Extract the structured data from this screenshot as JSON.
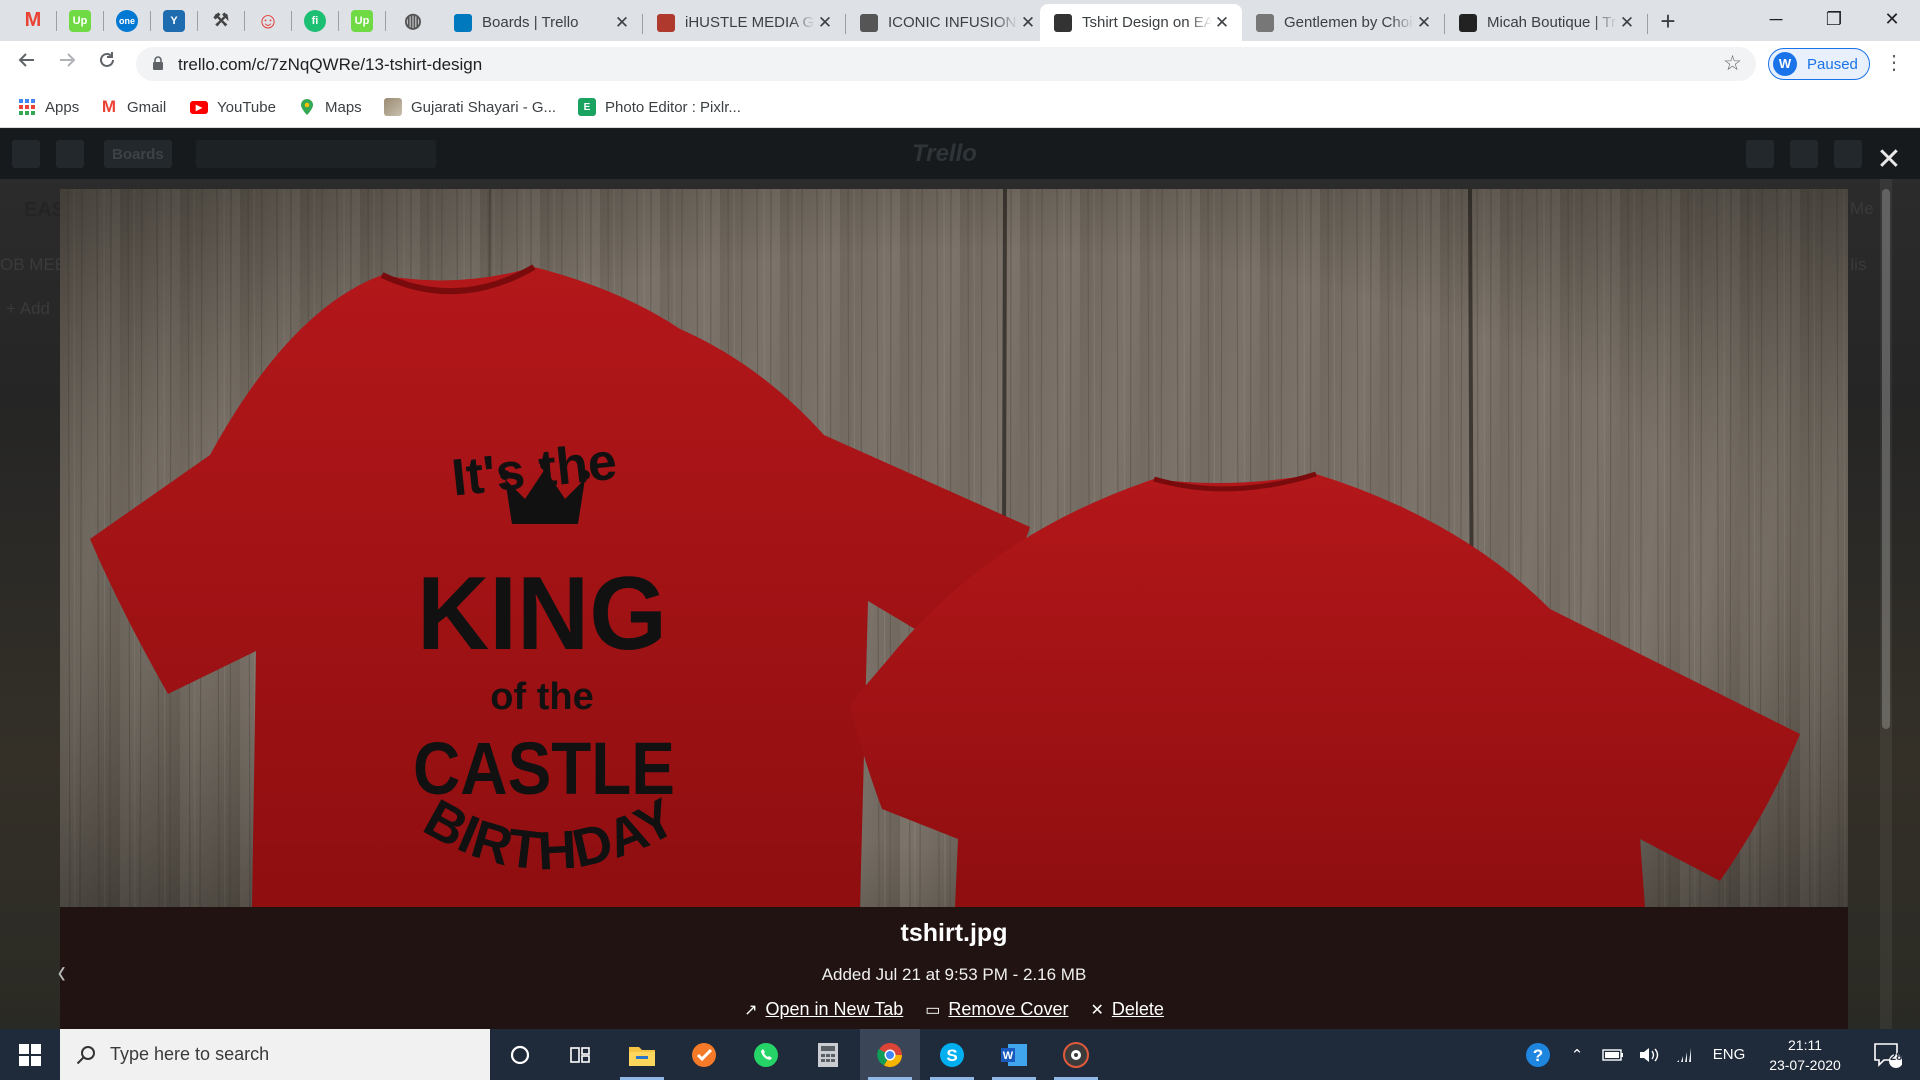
{
  "browser": {
    "pinned_tabs": [
      {
        "icon": "gmail-icon",
        "glyph": "M",
        "color": "#ea4335"
      },
      {
        "icon": "upwork-icon",
        "glyph": "Up",
        "color": "#6fda44"
      },
      {
        "icon": "onedrive-icon",
        "glyph": "one",
        "color": "#0078d4"
      },
      {
        "icon": "yammer-icon",
        "glyph": "Y",
        "color": "#1f6bb0"
      },
      {
        "icon": "tools-icon",
        "glyph": "⚒",
        "color": "#444444"
      },
      {
        "icon": "smiley-icon",
        "glyph": "☺",
        "color": "#e53935"
      },
      {
        "icon": "fiverr-icon",
        "glyph": "fi",
        "color": "#1dbf73"
      },
      {
        "icon": "upwork-icon",
        "glyph": "Up",
        "color": "#6fda44"
      },
      {
        "icon": "globe-icon",
        "glyph": "◍",
        "color": "#555555"
      }
    ],
    "tabs": [
      {
        "title": "Boards | Trello",
        "favicon_color": "#0079bf",
        "active": false
      },
      {
        "title": "iHUSTLE MEDIA GROUP",
        "favicon_color": "#b0392d",
        "active": false
      },
      {
        "title": "ICONIC INFUSION",
        "favicon_color": "#555555",
        "active": false
      },
      {
        "title": "Tshirt Design on EASY",
        "favicon_color": "#333333",
        "active": true
      },
      {
        "title": "Gentlemen by Choice",
        "favicon_color": "#777777",
        "active": false
      },
      {
        "title": "Micah Boutique | Trello",
        "favicon_color": "#222222",
        "active": false
      }
    ],
    "tab_close_glyph": "✕",
    "new_tab_glyph": "+",
    "window_controls": {
      "minimize": "─",
      "restore": "❐",
      "close": "✕"
    },
    "url": "trello.com/c/7zNqQWRe/13-tshirt-design",
    "profile_status": "Paused",
    "profile_initial": "W"
  },
  "bookmarks": [
    {
      "label": "Apps",
      "icon": "apps-grid-icon",
      "color": "#4285f4"
    },
    {
      "label": "Gmail",
      "icon": "gmail-icon",
      "color": "#ea4335"
    },
    {
      "label": "YouTube",
      "icon": "youtube-icon",
      "color": "#ff0000"
    },
    {
      "label": "Maps",
      "icon": "maps-pin-icon",
      "color": "#34a853"
    },
    {
      "label": "Gujarati Shayari - G...",
      "icon": "image-icon",
      "color": "#8a8a8a"
    },
    {
      "label": "Photo Editor : Pixlr...",
      "icon": "pixlr-icon",
      "color": "#1aa260"
    }
  ],
  "trello": {
    "header_boards": "Boards",
    "logo": "Trello",
    "background_fragments": [
      "EAS",
      "OB MEE",
      "+ Add",
      "Me",
      "r lis"
    ]
  },
  "attachment": {
    "filename": "tshirt.jpg",
    "meta": "Added Jul 21 at 9:53 PM - 2.16 MB",
    "actions": [
      {
        "label": "Open in New Tab",
        "icon": "external-link-icon",
        "glyph": "↗"
      },
      {
        "label": "Remove Cover",
        "icon": "card-cover-icon",
        "glyph": "▭"
      },
      {
        "label": "Delete",
        "icon": "close-icon",
        "glyph": "✕"
      }
    ],
    "shirt_text": [
      "It's the",
      "KING",
      "of the",
      "CASTLE",
      "BIRTHDAY"
    ],
    "shirt_color": "#a01010"
  },
  "taskbar": {
    "search_placeholder": "Type here to search",
    "apps": [
      {
        "name": "cortana-icon",
        "active": false
      },
      {
        "name": "task-view-icon",
        "active": false
      },
      {
        "name": "file-explorer-icon",
        "active": false
      },
      {
        "name": "todo-icon",
        "active": false
      },
      {
        "name": "whatsapp-icon",
        "active": false
      },
      {
        "name": "calculator-icon",
        "active": false
      },
      {
        "name": "chrome-icon",
        "active": true
      },
      {
        "name": "skype-icon",
        "active": false
      },
      {
        "name": "word-icon",
        "active": false
      },
      {
        "name": "media-player-icon",
        "active": false
      }
    ],
    "language": "ENG",
    "time": "21:11",
    "date": "23-07-2020",
    "notification_count": "28"
  }
}
